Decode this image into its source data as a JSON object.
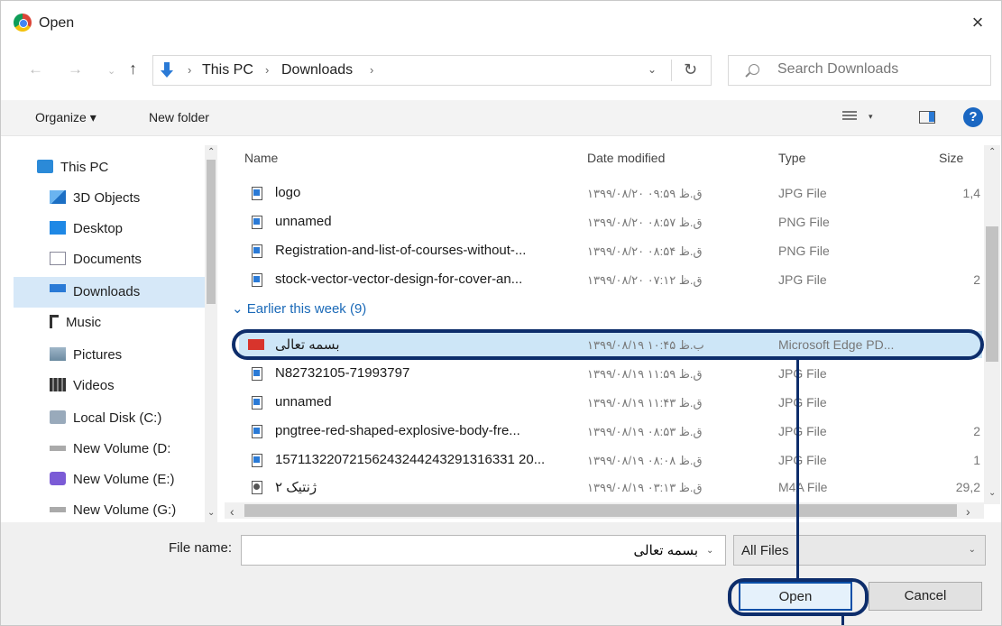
{
  "window": {
    "title": "Open",
    "close_glyph": "×",
    "accent": "#0d2d6b"
  },
  "nav": {
    "back_glyph": "←",
    "forward_glyph": "→",
    "recent_glyph": "⌄",
    "up_glyph": "↑",
    "breadcrumb": [
      "This PC",
      "Downloads"
    ],
    "sep_glyph": "›",
    "refresh_glyph": "↻",
    "search_placeholder": "Search Downloads"
  },
  "toolbar": {
    "organize_label": "Organize ▾",
    "new_folder_label": "New folder",
    "view_drop": "▾",
    "help_glyph": "?"
  },
  "sidebar": {
    "items": [
      {
        "label": "This PC",
        "icon": "pc"
      },
      {
        "label": "3D Objects",
        "icon": "3d"
      },
      {
        "label": "Desktop",
        "icon": "desk"
      },
      {
        "label": "Documents",
        "icon": "docs"
      },
      {
        "label": "Downloads",
        "icon": "dl",
        "selected": true
      },
      {
        "label": "Music",
        "icon": "music"
      },
      {
        "label": "Pictures",
        "icon": "pics"
      },
      {
        "label": "Videos",
        "icon": "vids"
      },
      {
        "label": "Local Disk (C:)",
        "icon": "disk"
      },
      {
        "label": "New Volume (D:",
        "icon": "vol"
      },
      {
        "label": "New Volume (E:)",
        "icon": "vs"
      },
      {
        "label": "New Volume (G:)",
        "icon": "vol"
      }
    ]
  },
  "columns": {
    "name": "Name",
    "date": "Date modified",
    "type": "Type",
    "size": "Size"
  },
  "groups": {
    "earlier": "Earlier this week (9)"
  },
  "files_top": [
    {
      "name": "logo",
      "date": "۱۳۹۹/۰۸/۲۰ ق.ظ ۰۹:۵۹",
      "type": "JPG File",
      "size": "1,4"
    },
    {
      "name": "unnamed",
      "date": "۱۳۹۹/۰۸/۲۰ ق.ظ ۰۸:۵۷",
      "type": "PNG File",
      "size": ""
    },
    {
      "name": "Registration-and-list-of-courses-without-...",
      "date": "۱۳۹۹/۰۸/۲۰ ق.ظ ۰۸:۵۴",
      "type": "PNG File",
      "size": ""
    },
    {
      "name": "stock-vector-vector-design-for-cover-an...",
      "date": "۱۳۹۹/۰۸/۲۰ ق.ظ ۰۷:۱۲",
      "type": "JPG File",
      "size": "2"
    }
  ],
  "files_earlier": [
    {
      "name": "بسمه تعالی",
      "date": "۱۳۹۹/۰۸/۱۹ ب.ظ ۱۰:۴۵",
      "type": "Microsoft Edge PD...",
      "size": "",
      "icon": "pdf",
      "highlight": true
    },
    {
      "name": "N82732105-71993797",
      "date": "۱۳۹۹/۰۸/۱۹ ق.ظ ۱۱:۵۹",
      "type": "JPG File",
      "size": ""
    },
    {
      "name": "unnamed",
      "date": "۱۳۹۹/۰۸/۱۹ ق.ظ ۱۱:۴۳",
      "type": "JPG File",
      "size": ""
    },
    {
      "name": "pngtree-red-shaped-explosive-body-fre...",
      "date": "۱۳۹۹/۰۸/۱۹ ق.ظ ۰۸:۵۳",
      "type": "JPG File",
      "size": "2"
    },
    {
      "name": "15711322072156243244243291316331 20...",
      "date": "۱۳۹۹/۰۸/۱۹ ق.ظ ۰۸:۰۸",
      "type": "JPG File",
      "size": "1"
    },
    {
      "name": "ژنتیک ۲",
      "date": "۱۳۹۹/۰۸/۱۹ ق.ظ ۰۳:۱۳",
      "type": "M4A File",
      "size": "29,2",
      "icon": "m4a"
    }
  ],
  "footer": {
    "filename_label": "File name:",
    "filename_value": "بسمه تعالی",
    "filetype_value": "All Files",
    "drop_glyph": "⌄",
    "open_label": "Open",
    "cancel_label": "Cancel"
  },
  "scroll": {
    "up": "⌃",
    "down": "⌄",
    "left": "‹",
    "right": "›"
  }
}
